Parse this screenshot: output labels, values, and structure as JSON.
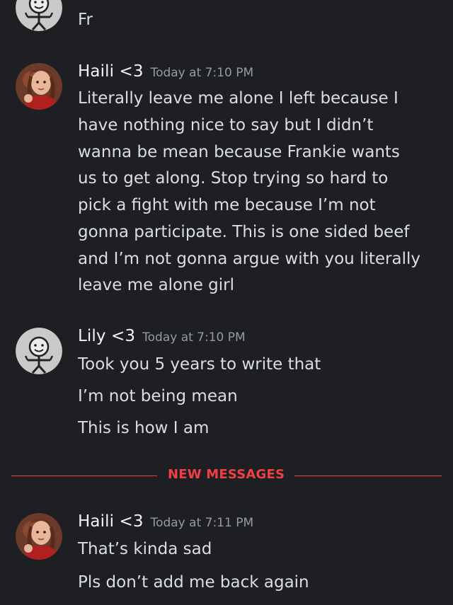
{
  "messages": {
    "top_partial": {
      "lines": [
        "Fr"
      ]
    },
    "m1": {
      "username": "Haili <3",
      "timestamp": "Today at 7:10 PM",
      "lines": [
        "Literally leave me alone I left because I",
        "have nothing nice to say but I didn’t",
        "wanna be mean because Frankie wants",
        "us to get along. Stop trying so hard to",
        "pick a fight with me because I’m not",
        "gonna participate. This is one sided beef",
        "and I’m not gonna argue with you literally",
        "leave me alone girl"
      ]
    },
    "m2": {
      "username": "Lily <3",
      "timestamp": "Today at 7:10 PM",
      "lines": [
        "Took you 5 years to write that",
        "I’m not being mean",
        "This is how I am"
      ]
    },
    "divider": {
      "label": "NEW MESSAGES"
    },
    "m3": {
      "username": "Haili <3",
      "timestamp": "Today at 7:11 PM",
      "lines": [
        "That’s kinda sad",
        "Pls don’t add me back again"
      ]
    }
  },
  "colors": {
    "background": "#1e1f22",
    "username": "#f2f3f5",
    "timestamp": "#949ba4",
    "text": "#dbdee1",
    "new_messages": "#f23f42"
  },
  "icons": {
    "lily_avatar": "stick-figure-face-icon",
    "haili_avatar": "photo-avatar"
  }
}
